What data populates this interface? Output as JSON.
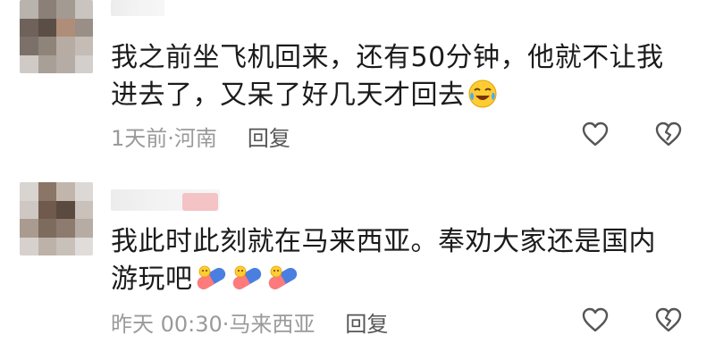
{
  "comments": [
    {
      "lines": [
        "我之前坐飞机回来，还有50分钟，他就不让我",
        "进去了，又呆了好几天才回去"
      ],
      "trailing_emoji": "laughing-crying-emoji",
      "time_location": "1天前·河南",
      "reply_label": "回复",
      "avatar_colors": [
        "#b9b3ad",
        "#8b8077",
        "#a39a92",
        "#c9c4bf",
        "#6e625a",
        "#5a4e47",
        "#b08d78",
        "#9a8f86",
        "#7c716a",
        "#8f8479",
        "#b7aca3",
        "#c4bcb5",
        "#cfcac6",
        "#a8a097",
        "#b5aca5",
        "#d3cfcc"
      ]
    },
    {
      "lines": [
        "我此时此刻就在马来西亚。奉劝大家还是国内",
        "游玩吧"
      ],
      "trailing_emoji": "pill-emoji",
      "trailing_emoji_count": 3,
      "time_location": "昨天 00:30·马来西亚",
      "reply_label": "回复",
      "avatar_colors": [
        "#d8d4d0",
        "#8a7566",
        "#c2b6ac",
        "#dcd8d5",
        "#cfc8c2",
        "#6f5a4d",
        "#5b4a40",
        "#c9c1ba",
        "#a99b90",
        "#7d6b5e",
        "#8c7b6e",
        "#b7aca3",
        "#d6d1cd",
        "#bdb2a9",
        "#c8c0b9",
        "#e0dcd9"
      ]
    }
  ],
  "colors": {
    "text": "#1b1b1b",
    "meta": "#9a9a9a",
    "reply": "#555555",
    "icon": "#555555",
    "vip_badge": "#f3c3c6"
  }
}
